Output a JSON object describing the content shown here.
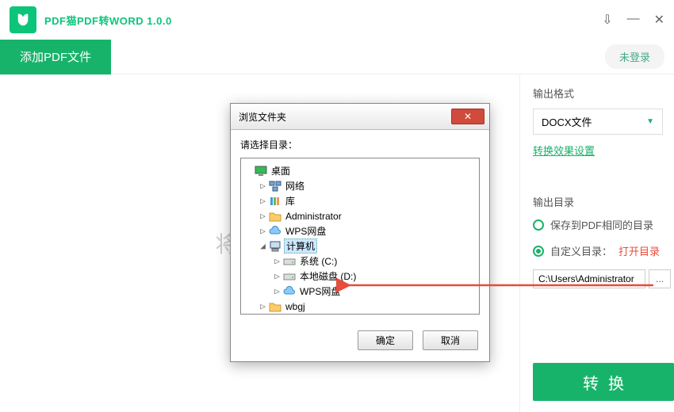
{
  "app": {
    "title": "PDF猫PDF转WORD 1.0.0"
  },
  "toolbar": {
    "add_file": "添加PDF文件",
    "login": "未登录"
  },
  "placeholder_text": "将PDF文",
  "output": {
    "format_label": "输出格式",
    "format_value": "DOCX文件",
    "effect_link": "转换效果设置",
    "dir_label": "输出目录",
    "radio_same": "保存到PDF相同的目录",
    "radio_custom": "自定义目录：",
    "open_dir": "打开目录",
    "path_value": "C:\\Users\\Administrator",
    "browse_btn": "...",
    "convert": "转换"
  },
  "dialog": {
    "title": "浏览文件夹",
    "prompt": "请选择目录：",
    "ok": "确定",
    "cancel": "取消",
    "tree": [
      {
        "label": "桌面",
        "indent": 0,
        "twisty": "",
        "icon": "monitor"
      },
      {
        "label": "网络",
        "indent": 1,
        "twisty": "▷",
        "icon": "network"
      },
      {
        "label": "库",
        "indent": 1,
        "twisty": "▷",
        "icon": "library"
      },
      {
        "label": "Administrator",
        "indent": 1,
        "twisty": "▷",
        "icon": "folder"
      },
      {
        "label": "WPS网盘",
        "indent": 1,
        "twisty": "▷",
        "icon": "cloud"
      },
      {
        "label": "计算机",
        "indent": 1,
        "twisty": "◢",
        "icon": "computer",
        "selected": true
      },
      {
        "label": "系统 (C:)",
        "indent": 2,
        "twisty": "▷",
        "icon": "drive"
      },
      {
        "label": "本地磁盘 (D:)",
        "indent": 2,
        "twisty": "▷",
        "icon": "drive"
      },
      {
        "label": "WPS网盘",
        "indent": 2,
        "twisty": "▷",
        "icon": "cloud"
      },
      {
        "label": "wbgj",
        "indent": 1,
        "twisty": "▷",
        "icon": "folder"
      }
    ]
  }
}
